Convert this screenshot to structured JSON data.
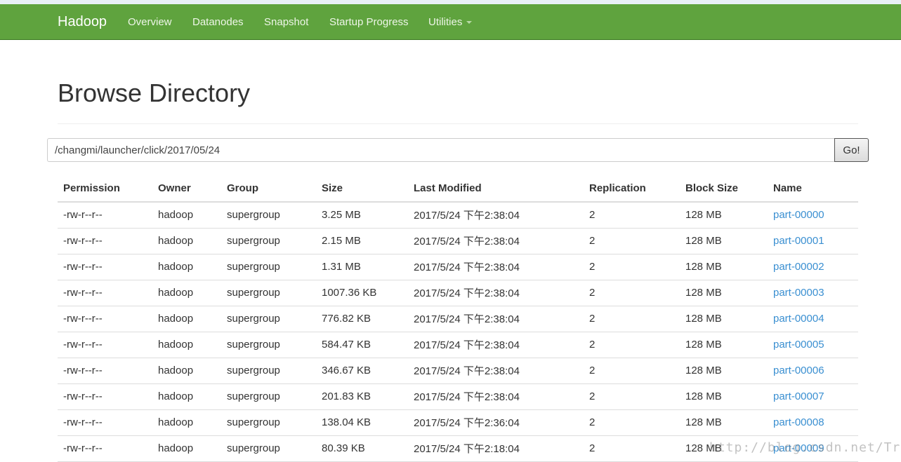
{
  "navbar": {
    "brand": "Hadoop",
    "items": [
      {
        "label": "Overview"
      },
      {
        "label": "Datanodes"
      },
      {
        "label": "Snapshot"
      },
      {
        "label": "Startup Progress"
      },
      {
        "label": "Utilities",
        "dropdown": true
      }
    ],
    "color": "#5fa33e"
  },
  "page": {
    "title": "Browse Directory"
  },
  "path_bar": {
    "value": "/changmi/launcher/click/2017/05/24",
    "go_label": "Go!"
  },
  "table": {
    "columns": [
      "Permission",
      "Owner",
      "Group",
      "Size",
      "Last Modified",
      "Replication",
      "Block Size",
      "Name"
    ],
    "rows": [
      [
        "-rw-r--r--",
        "hadoop",
        "supergroup",
        "3.25 MB",
        "2017/5/24 下午2:38:04",
        "2",
        "128 MB",
        "part-00000"
      ],
      [
        "-rw-r--r--",
        "hadoop",
        "supergroup",
        "2.15 MB",
        "2017/5/24 下午2:38:04",
        "2",
        "128 MB",
        "part-00001"
      ],
      [
        "-rw-r--r--",
        "hadoop",
        "supergroup",
        "1.31 MB",
        "2017/5/24 下午2:38:04",
        "2",
        "128 MB",
        "part-00002"
      ],
      [
        "-rw-r--r--",
        "hadoop",
        "supergroup",
        "1007.36 KB",
        "2017/5/24 下午2:38:04",
        "2",
        "128 MB",
        "part-00003"
      ],
      [
        "-rw-r--r--",
        "hadoop",
        "supergroup",
        "776.82 KB",
        "2017/5/24 下午2:38:04",
        "2",
        "128 MB",
        "part-00004"
      ],
      [
        "-rw-r--r--",
        "hadoop",
        "supergroup",
        "584.47 KB",
        "2017/5/24 下午2:38:04",
        "2",
        "128 MB",
        "part-00005"
      ],
      [
        "-rw-r--r--",
        "hadoop",
        "supergroup",
        "346.67 KB",
        "2017/5/24 下午2:38:04",
        "2",
        "128 MB",
        "part-00006"
      ],
      [
        "-rw-r--r--",
        "hadoop",
        "supergroup",
        "201.83 KB",
        "2017/5/24 下午2:38:04",
        "2",
        "128 MB",
        "part-00007"
      ],
      [
        "-rw-r--r--",
        "hadoop",
        "supergroup",
        "138.04 KB",
        "2017/5/24 下午2:36:04",
        "2",
        "128 MB",
        "part-00008"
      ],
      [
        "-rw-r--r--",
        "hadoop",
        "supergroup",
        "80.39 KB",
        "2017/5/24 下午2:18:04",
        "2",
        "128 MB",
        "part-00009"
      ]
    ],
    "link_color": "#3a8fd1"
  },
  "watermark": "http://blog.csdn.net/Trigl"
}
